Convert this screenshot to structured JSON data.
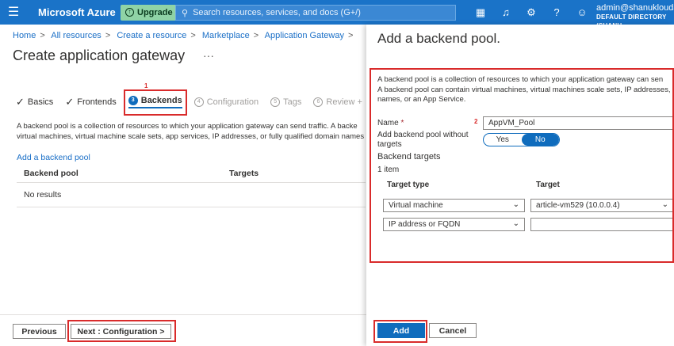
{
  "topbar": {
    "menu_icon": "hamburger-icon",
    "brand": "Microsoft Azure",
    "upgrade_label": "Upgrade",
    "search_placeholder": "Search resources, services, and docs (G+/)",
    "icons": [
      "cloud-shell-icon",
      "bell-icon",
      "gear-icon",
      "help-icon",
      "feedback-icon"
    ],
    "user_name": "admin@shanukloudа",
    "user_directory": "DEFAULT DIRECTORY (SHANU"
  },
  "breadcrumb": [
    "Home",
    "All resources",
    "Create a resource",
    "Marketplace",
    "Application Gateway"
  ],
  "page": {
    "title": "Create application gateway",
    "more": "···"
  },
  "tabs": [
    {
      "label": "Basics",
      "state": "done"
    },
    {
      "label": "Frontends",
      "state": "done"
    },
    {
      "label": "Backends",
      "num": "3",
      "state": "active"
    },
    {
      "label": "Configuration",
      "num": "4",
      "state": "disabled"
    },
    {
      "label": "Tags",
      "num": "5",
      "state": "disabled"
    },
    {
      "label": "Review +",
      "num": "6",
      "state": "disabled"
    }
  ],
  "annotations": {
    "one": "1",
    "two": "2"
  },
  "main": {
    "description_line1": "A backend pool is a collection of resources to which your application gateway can send traffic. A backe",
    "description_line2": "virtual machines, virtual machine scale sets, app services, IP addresses, or fully qualified domain names",
    "add_link": "Add a backend pool",
    "table_headers": [
      "Backend pool",
      "Targets"
    ],
    "empty_text": "No results"
  },
  "footer": {
    "previous": "Previous",
    "next": "Next : Configuration >"
  },
  "panel": {
    "title": "Add a backend pool.",
    "desc_line1": "A backend pool is a collection of resources to which your application gateway can sen",
    "desc_line2": "A backend pool can contain virtual machines, virtual machines scale sets, IP addresses,",
    "desc_line3": "names, or an App Service.",
    "name_label": "Name",
    "name_required": "*",
    "name_value": "AppVM_Pool",
    "no_targets_label_1": "Add backend pool without",
    "no_targets_label_2": "targets",
    "toggle_yes": "Yes",
    "toggle_no": "No",
    "targets_heading": "Backend targets",
    "count": "1 item",
    "col_type": "Target type",
    "col_target": "Target",
    "rows": [
      {
        "type": "Virtual machine",
        "target": "article-vm529 (10.0.0.4)"
      },
      {
        "type": "IP address or FQDN",
        "target": ""
      }
    ],
    "add": "Add",
    "cancel": "Cancel"
  },
  "colors": {
    "azure_blue": "#0f6cbd",
    "highlight_red": "#d92b2b"
  }
}
